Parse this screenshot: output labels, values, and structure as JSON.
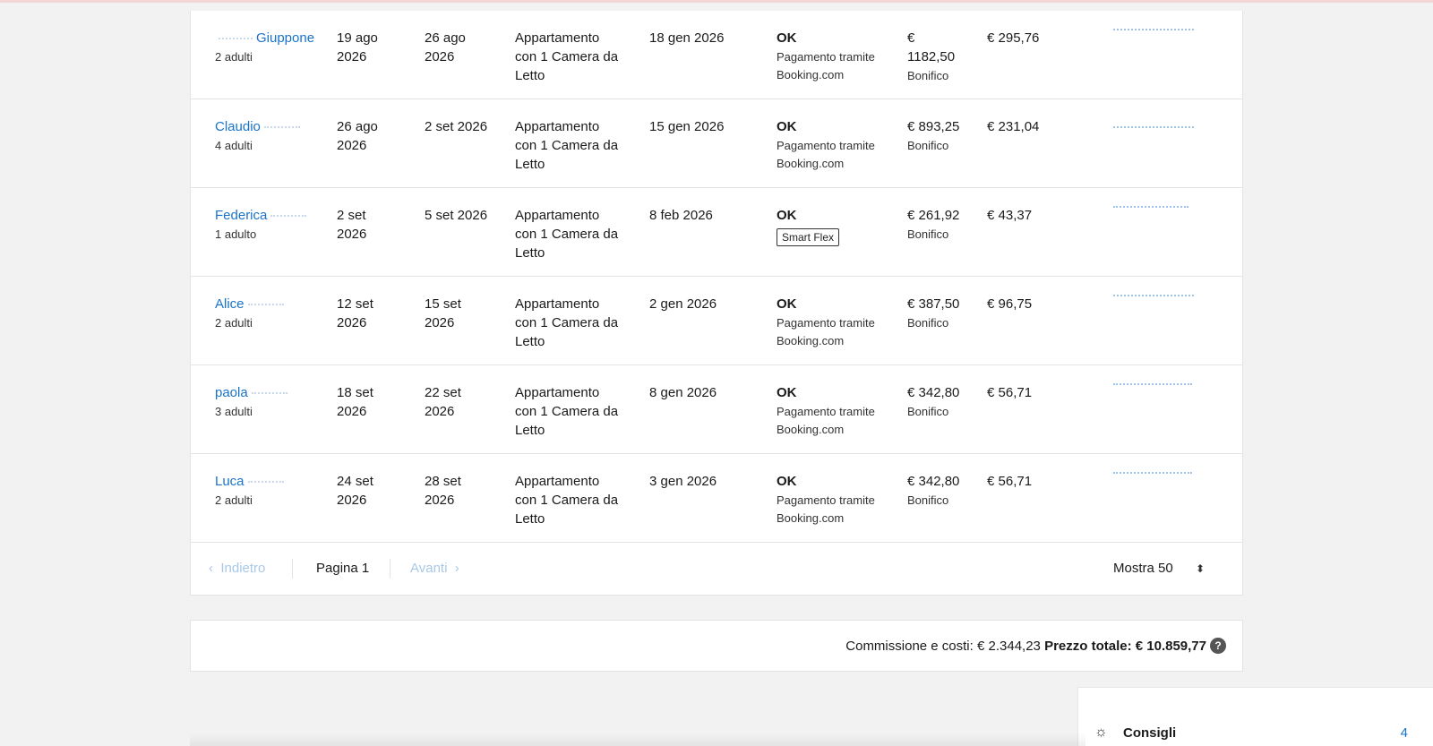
{
  "reservations": [
    {
      "guest_prefix": "",
      "guest_name": "Giuppone",
      "guests": "2 adulti",
      "check_in": [
        "19 ago",
        "2026"
      ],
      "check_out": [
        "26 ago",
        "2026"
      ],
      "room": [
        "Appartamento",
        "con 1 Camera da",
        "Letto"
      ],
      "booked_on": "18 gen 2026",
      "status": "OK",
      "payment_lines": [
        "Pagamento tramite",
        "Booking.com"
      ],
      "badge": "",
      "price_lines": [
        "€",
        "1182,50"
      ],
      "price_method": "Bonifico",
      "commission": "€ 295,76"
    },
    {
      "guest_prefix": "Claudio",
      "guest_name": "",
      "guests": "4 adulti",
      "check_in": [
        "26 ago",
        "2026"
      ],
      "check_out": [
        "2 set 2026"
      ],
      "room": [
        "Appartamento",
        "con 1 Camera da",
        "Letto"
      ],
      "booked_on": "15 gen 2026",
      "status": "OK",
      "payment_lines": [
        "Pagamento tramite",
        "Booking.com"
      ],
      "badge": "",
      "price_lines": [
        "€ 893,25"
      ],
      "price_method": "Bonifico",
      "commission": "€ 231,04"
    },
    {
      "guest_prefix": "Federica",
      "guest_name": "",
      "guests": "1 adulto",
      "check_in": [
        "2 set",
        "2026"
      ],
      "check_out": [
        "5 set 2026"
      ],
      "room": [
        "Appartamento",
        "con 1 Camera da",
        "Letto"
      ],
      "booked_on": "8 feb 2026",
      "status": "OK",
      "payment_lines": [],
      "badge": "Smart Flex",
      "price_lines": [
        "€ 261,92"
      ],
      "price_method": "Bonifico",
      "commission": "€ 43,37"
    },
    {
      "guest_prefix": "Alice",
      "guest_name": "",
      "guests": "2 adulti",
      "check_in": [
        "12 set",
        "2026"
      ],
      "check_out": [
        "15 set",
        "2026"
      ],
      "room": [
        "Appartamento",
        "con 1 Camera da",
        "Letto"
      ],
      "booked_on": "2 gen 2026",
      "status": "OK",
      "payment_lines": [
        "Pagamento tramite",
        "Booking.com"
      ],
      "badge": "",
      "price_lines": [
        "€ 387,50"
      ],
      "price_method": "Bonifico",
      "commission": "€ 96,75"
    },
    {
      "guest_prefix": "paola",
      "guest_name": "",
      "guests": "3 adulti",
      "check_in": [
        "18 set",
        "2026"
      ],
      "check_out": [
        "22 set",
        "2026"
      ],
      "room": [
        "Appartamento",
        "con 1 Camera da",
        "Letto"
      ],
      "booked_on": "8 gen 2026",
      "status": "OK",
      "payment_lines": [
        "Pagamento tramite",
        "Booking.com"
      ],
      "badge": "",
      "price_lines": [
        "€ 342,80"
      ],
      "price_method": "Bonifico",
      "commission": "€ 56,71"
    },
    {
      "guest_prefix": "Luca",
      "guest_name": "",
      "guests": "2 adulti",
      "check_in": [
        "24 set",
        "2026"
      ],
      "check_out": [
        "28 set",
        "2026"
      ],
      "room": [
        "Appartamento",
        "con 1 Camera da",
        "Letto"
      ],
      "booked_on": "3 gen 2026",
      "status": "OK",
      "payment_lines": [
        "Pagamento tramite",
        "Booking.com"
      ],
      "badge": "",
      "price_lines": [
        "€ 342,80"
      ],
      "price_method": "Bonifico",
      "commission": "€ 56,71"
    }
  ],
  "pager": {
    "back_label": "Indietro",
    "page_label": "Pagina 1",
    "next_label": "Avanti",
    "show_label": "Mostra 50"
  },
  "totals": {
    "commission_label": "Commissione e costi:",
    "commission_value": "€ 2.344,23",
    "total_label": "Prezzo totale:",
    "total_value": "€ 10.859,77",
    "help": "?"
  },
  "tips": {
    "label": "Consigli",
    "count": "4"
  },
  "colors": {
    "link": "#1a73c8",
    "disabled_link": "#a9c8e8",
    "background": "#f2f2f2"
  }
}
